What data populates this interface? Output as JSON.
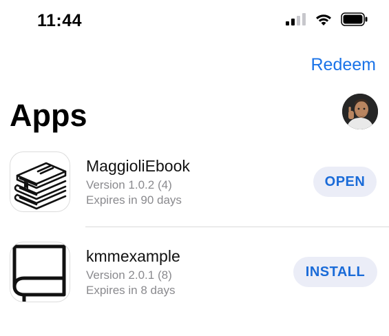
{
  "status_bar": {
    "time": "11:44"
  },
  "header": {
    "redeem_label": "Redeem",
    "title": "Apps"
  },
  "apps": [
    {
      "name": "MaggioliEbook",
      "version": "Version 1.0.2 (4)",
      "expiry": "Expires in 90 days",
      "action": "OPEN",
      "icon": "books-stack-icon"
    },
    {
      "name": "kmmexample",
      "version": "Version 2.0.1 (8)",
      "expiry": "Expires in 8 days",
      "action": "INSTALL",
      "icon": "book-icon"
    }
  ],
  "colors": {
    "accent": "#1a73e8",
    "button_bg": "#ebedf7",
    "secondary_text": "#8a8a8e"
  }
}
